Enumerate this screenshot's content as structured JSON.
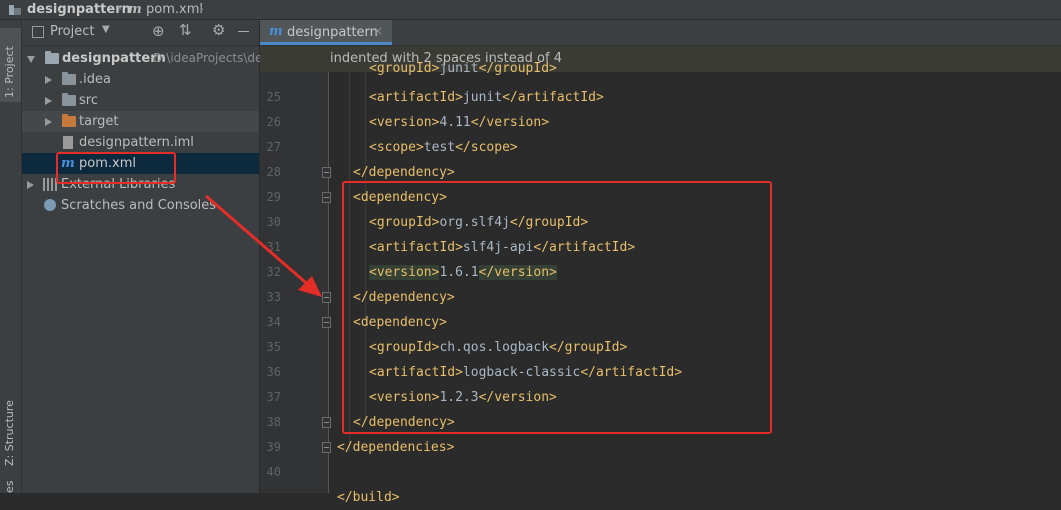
{
  "breadcrumb": {
    "project": "designpattern",
    "file_icon": "m",
    "file": "pom.xml"
  },
  "left_strip": {
    "project_tab": "1: Project",
    "structure_tab": "Z: Structure",
    "bottom_tab": "es"
  },
  "project_panel": {
    "header_label": "Project",
    "tree": [
      {
        "label": "designpattern",
        "path": "D:\\ideaProjects\\designpattern"
      },
      {
        "label": ".idea"
      },
      {
        "label": "src"
      },
      {
        "label": "target"
      },
      {
        "label": "designpattern.iml"
      },
      {
        "label": "pom.xml",
        "icon": "m"
      },
      {
        "label": "External Libraries"
      },
      {
        "label": "Scratches and Consoles"
      }
    ]
  },
  "editor": {
    "tab_label": "designpattern",
    "tab_icon": "m",
    "notice": "indented with 2 spaces instead of 4",
    "lines": [
      {
        "n": "25",
        "indent": 2,
        "open": "<artifactId>",
        "text": "junit",
        "close": "</artifactId>"
      },
      {
        "n": "26",
        "indent": 2,
        "open": "<version>",
        "text": "4.11",
        "close": "</version>"
      },
      {
        "n": "27",
        "indent": 2,
        "open": "<scope>",
        "text": "test",
        "close": "</scope>"
      },
      {
        "n": "28",
        "indent": 1,
        "open": "</dependency>",
        "text": "",
        "close": ""
      },
      {
        "n": "29",
        "indent": 1,
        "open": "<dependency>",
        "text": "",
        "close": ""
      },
      {
        "n": "30",
        "indent": 2,
        "open": "<groupId>",
        "text": "org.slf4j",
        "close": "</groupId>"
      },
      {
        "n": "31",
        "indent": 2,
        "open": "<artifactId>",
        "text": "slf4j-api",
        "close": "</artifactId>"
      },
      {
        "n": "32",
        "indent": 2,
        "open": "<version>",
        "text": "1.6.1",
        "close": "</version>"
      },
      {
        "n": "33",
        "indent": 1,
        "open": "</dependency>",
        "text": "",
        "close": ""
      },
      {
        "n": "34",
        "indent": 1,
        "open": "<dependency>",
        "text": "",
        "close": ""
      },
      {
        "n": "35",
        "indent": 2,
        "open": "<groupId>",
        "text": "ch.qos.logback",
        "close": "</groupId>"
      },
      {
        "n": "36",
        "indent": 2,
        "open": "<artifactId>",
        "text": "logback-classic",
        "close": "</artifactId>"
      },
      {
        "n": "37",
        "indent": 2,
        "open": "<version>",
        "text": "1.2.3",
        "close": "</version>"
      },
      {
        "n": "38",
        "indent": 1,
        "open": "</dependency>",
        "text": "",
        "close": ""
      },
      {
        "n": "39",
        "indent": 0,
        "open": "</dependencies>",
        "text": "",
        "close": ""
      },
      {
        "n": "40",
        "indent": 0,
        "open": "",
        "text": "",
        "close": ""
      }
    ],
    "partial_top": {
      "open": "<groupId>",
      "text": "junit",
      "close": "</groupId>"
    },
    "partial_bottom": {
      "open": "</build>"
    }
  },
  "colors": {
    "annotation": "#e52d27",
    "tag": "#e8bf6a",
    "text": "#a9b7c6",
    "selection": "#0d293e"
  }
}
